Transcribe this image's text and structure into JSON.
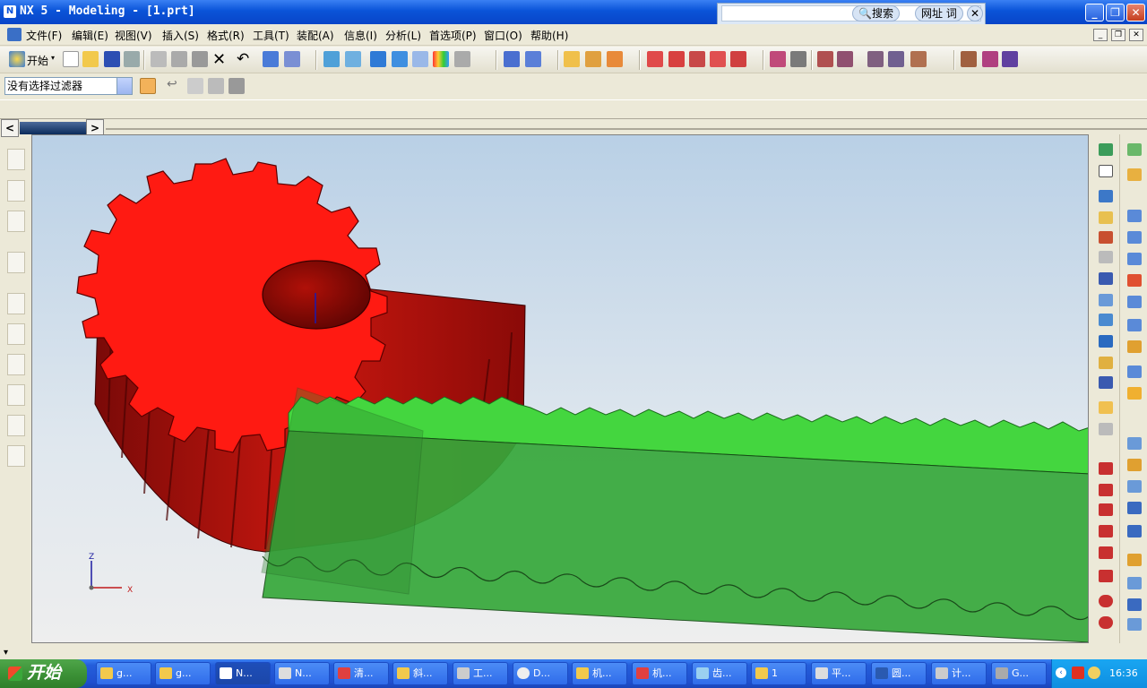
{
  "window": {
    "title": "NX 5 - Modeling - [1.prt]",
    "logo": "N",
    "buttons": {
      "minimize": "_",
      "maximize": "❐",
      "close": "✕"
    }
  },
  "search_widget": {
    "search_label": "搜索",
    "url_label": "网址",
    "word_label": "词",
    "close": "✕"
  },
  "menu": {
    "items": [
      "文件(F)",
      "编辑(E)",
      "视图(V)",
      "插入(S)",
      "格式(R)",
      "工具(T)",
      "装配(A)",
      "信息(I)",
      "分析(L)",
      "首选项(P)",
      "窗口(O)",
      "帮助(H)"
    ],
    "mdi_buttons": [
      "_",
      "❐",
      "✕"
    ]
  },
  "toolbar": {
    "start_label": "开始"
  },
  "selection_bar": {
    "filter_value": "没有选择过滤器"
  },
  "tabstrip": {
    "left_arrow": "<",
    "right_arrow": ">"
  },
  "viewport": {
    "triad": {
      "z": "Z",
      "x": "X"
    },
    "colors": {
      "gear": "#ff1a12",
      "rack": "#3fcf3f",
      "bg_top": "#b9d0e6",
      "bg_bottom": "#eeeeee"
    }
  },
  "statusbar": {
    "text": "▾"
  },
  "taskbar": {
    "start_label": "开始",
    "buttons": [
      {
        "label": "g...",
        "icon": "folder-icon"
      },
      {
        "label": "g...",
        "icon": "folder-icon"
      },
      {
        "label": "N...",
        "icon": "nx-icon",
        "active": true
      },
      {
        "label": "N...",
        "icon": "window-icon"
      },
      {
        "label": "清...",
        "icon": "pdf-icon"
      },
      {
        "label": "斜...",
        "icon": "folder-icon"
      },
      {
        "label": "工...",
        "icon": "tool-icon"
      },
      {
        "label": "D...",
        "icon": "search-icon"
      },
      {
        "label": "机...",
        "icon": "folder-icon"
      },
      {
        "label": "机...",
        "icon": "pdf-icon"
      },
      {
        "label": "齿...",
        "icon": "doc-icon"
      },
      {
        "label": "1",
        "icon": "folder-icon"
      },
      {
        "label": "平...",
        "icon": "window-icon"
      },
      {
        "label": "圆...",
        "icon": "word-icon"
      },
      {
        "label": "计...",
        "icon": "calc-icon"
      },
      {
        "label": "G...",
        "icon": "app-icon"
      }
    ],
    "tray": {
      "time": "16:36"
    }
  }
}
